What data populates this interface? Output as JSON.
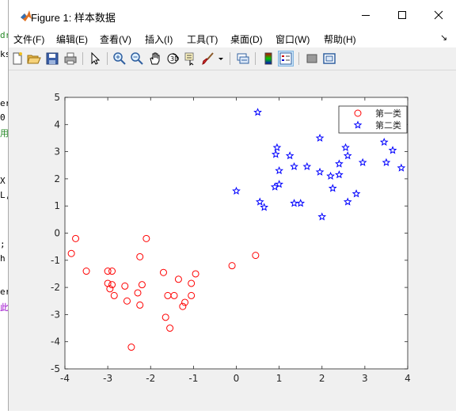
{
  "window": {
    "title": "Figure 1: 样本数据"
  },
  "background_fragments": [
    "dr",
    "ks",
    "er",
    "0",
    "用",
    "X",
    "L,",
    ";",
    "h",
    "er",
    "此"
  ],
  "menu": [
    "文件(F)",
    "编辑(E)",
    "查看(V)",
    "插入(I)",
    "工具(T)",
    "桌面(D)",
    "窗口(W)",
    "帮助(H)"
  ],
  "toolbar_icons": [
    "new-figure-icon",
    "open-icon",
    "save-icon",
    "print-icon",
    "pointer-icon",
    "zoom-in-icon",
    "zoom-out-icon",
    "pan-icon",
    "rotate-icon",
    "data-cursor-icon",
    "brush-icon",
    "brush-dropdown-icon",
    "link-plot-icon",
    "colorbar-icon",
    "legend-icon",
    "hide-plot-tools-icon",
    "show-plot-tools-icon"
  ],
  "chart_data": {
    "type": "scatter",
    "xlim": [
      -4,
      4
    ],
    "ylim": [
      -5,
      5
    ],
    "xticks": [
      "-4",
      "-3",
      "-2",
      "-1",
      "0",
      "1",
      "2",
      "3",
      "4"
    ],
    "yticks": [
      "5",
      "4",
      "3",
      "2",
      "1",
      "0",
      "-1",
      "-2",
      "-3",
      "-4",
      "-5"
    ],
    "grid": false,
    "legend_position": "top-right",
    "series": [
      {
        "name": "第一类",
        "marker": "circle",
        "color": "#ff0000",
        "points": [
          [
            -3.85,
            -0.75
          ],
          [
            -3.75,
            -0.2
          ],
          [
            -3.5,
            -1.4
          ],
          [
            -3.0,
            -1.4
          ],
          [
            -3.0,
            -1.85
          ],
          [
            -2.95,
            -2.05
          ],
          [
            -2.9,
            -1.4
          ],
          [
            -2.9,
            -1.9
          ],
          [
            -2.85,
            -2.3
          ],
          [
            -2.6,
            -1.95
          ],
          [
            -2.55,
            -2.5
          ],
          [
            -2.45,
            -4.2
          ],
          [
            -2.3,
            -2.2
          ],
          [
            -2.25,
            -2.65
          ],
          [
            -2.25,
            -0.87
          ],
          [
            -2.2,
            -1.9
          ],
          [
            -2.1,
            -0.2
          ],
          [
            -1.7,
            -1.45
          ],
          [
            -1.65,
            -3.1
          ],
          [
            -1.6,
            -2.3
          ],
          [
            -1.55,
            -3.5
          ],
          [
            -1.45,
            -2.3
          ],
          [
            -1.35,
            -1.7
          ],
          [
            -1.25,
            -2.7
          ],
          [
            -1.2,
            -2.55
          ],
          [
            -1.05,
            -2.3
          ],
          [
            -1.05,
            -1.85
          ],
          [
            -0.95,
            -1.5
          ],
          [
            -0.1,
            -1.2
          ],
          [
            0.45,
            -0.82
          ]
        ]
      },
      {
        "name": "第二类",
        "marker": "star",
        "color": "#0000ff",
        "points": [
          [
            0.0,
            1.55
          ],
          [
            0.5,
            4.45
          ],
          [
            0.55,
            1.15
          ],
          [
            0.65,
            0.95
          ],
          [
            0.9,
            1.7
          ],
          [
            0.92,
            2.9
          ],
          [
            0.95,
            3.15
          ],
          [
            1.0,
            1.8
          ],
          [
            1.0,
            2.3
          ],
          [
            1.25,
            2.85
          ],
          [
            1.35,
            1.1
          ],
          [
            1.35,
            2.45
          ],
          [
            1.5,
            1.1
          ],
          [
            1.65,
            2.45
          ],
          [
            1.95,
            3.5
          ],
          [
            1.95,
            2.25
          ],
          [
            2.0,
            0.6
          ],
          [
            2.2,
            2.1
          ],
          [
            2.25,
            1.65
          ],
          [
            2.4,
            2.15
          ],
          [
            2.4,
            2.55
          ],
          [
            2.55,
            3.15
          ],
          [
            2.6,
            2.85
          ],
          [
            2.6,
            1.15
          ],
          [
            2.8,
            1.45
          ],
          [
            2.95,
            2.6
          ],
          [
            3.45,
            3.35
          ],
          [
            3.5,
            2.6
          ],
          [
            3.65,
            3.05
          ],
          [
            3.85,
            2.4
          ]
        ]
      }
    ]
  }
}
